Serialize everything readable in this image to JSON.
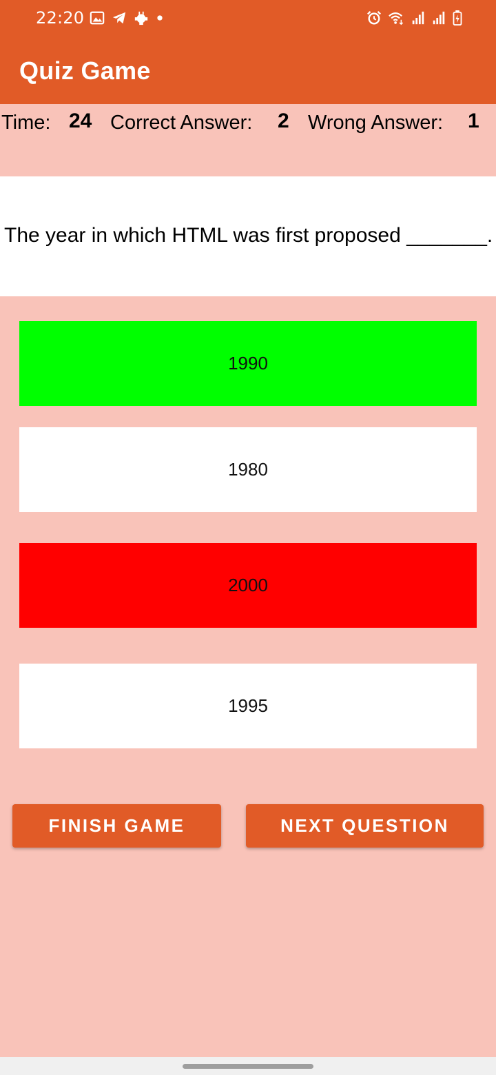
{
  "status_bar": {
    "time": "22:20",
    "left_icons": [
      "gallery-icon",
      "telegram-icon",
      "android-icon",
      "dot-icon"
    ],
    "right_icons": [
      "alarm-icon",
      "wifi-icon",
      "signal-icon",
      "signal-icon",
      "battery-icon"
    ]
  },
  "app_bar": {
    "title": "Quiz Game"
  },
  "score": {
    "time_label": "Time:",
    "time_value": "24",
    "correct_label": "Correct Answer:",
    "correct_value": "2",
    "wrong_label": "Wrong Answer:",
    "wrong_value": "1"
  },
  "question": {
    "text": "The year in which HTML was first proposed _______."
  },
  "answers": [
    {
      "label": "1990",
      "color": "#00FF00"
    },
    {
      "label": "1980",
      "color": "#FFFFFF"
    },
    {
      "label": "2000",
      "color": "#FF0000"
    },
    {
      "label": "1995",
      "color": "#FFFFFF"
    }
  ],
  "buttons": {
    "finish": "FINISH GAME",
    "next": "NEXT QUESTION"
  },
  "colors": {
    "primary": "#E15B27",
    "background": "#F9C3B9",
    "correct": "#00FF00",
    "wrong": "#FF0000"
  }
}
